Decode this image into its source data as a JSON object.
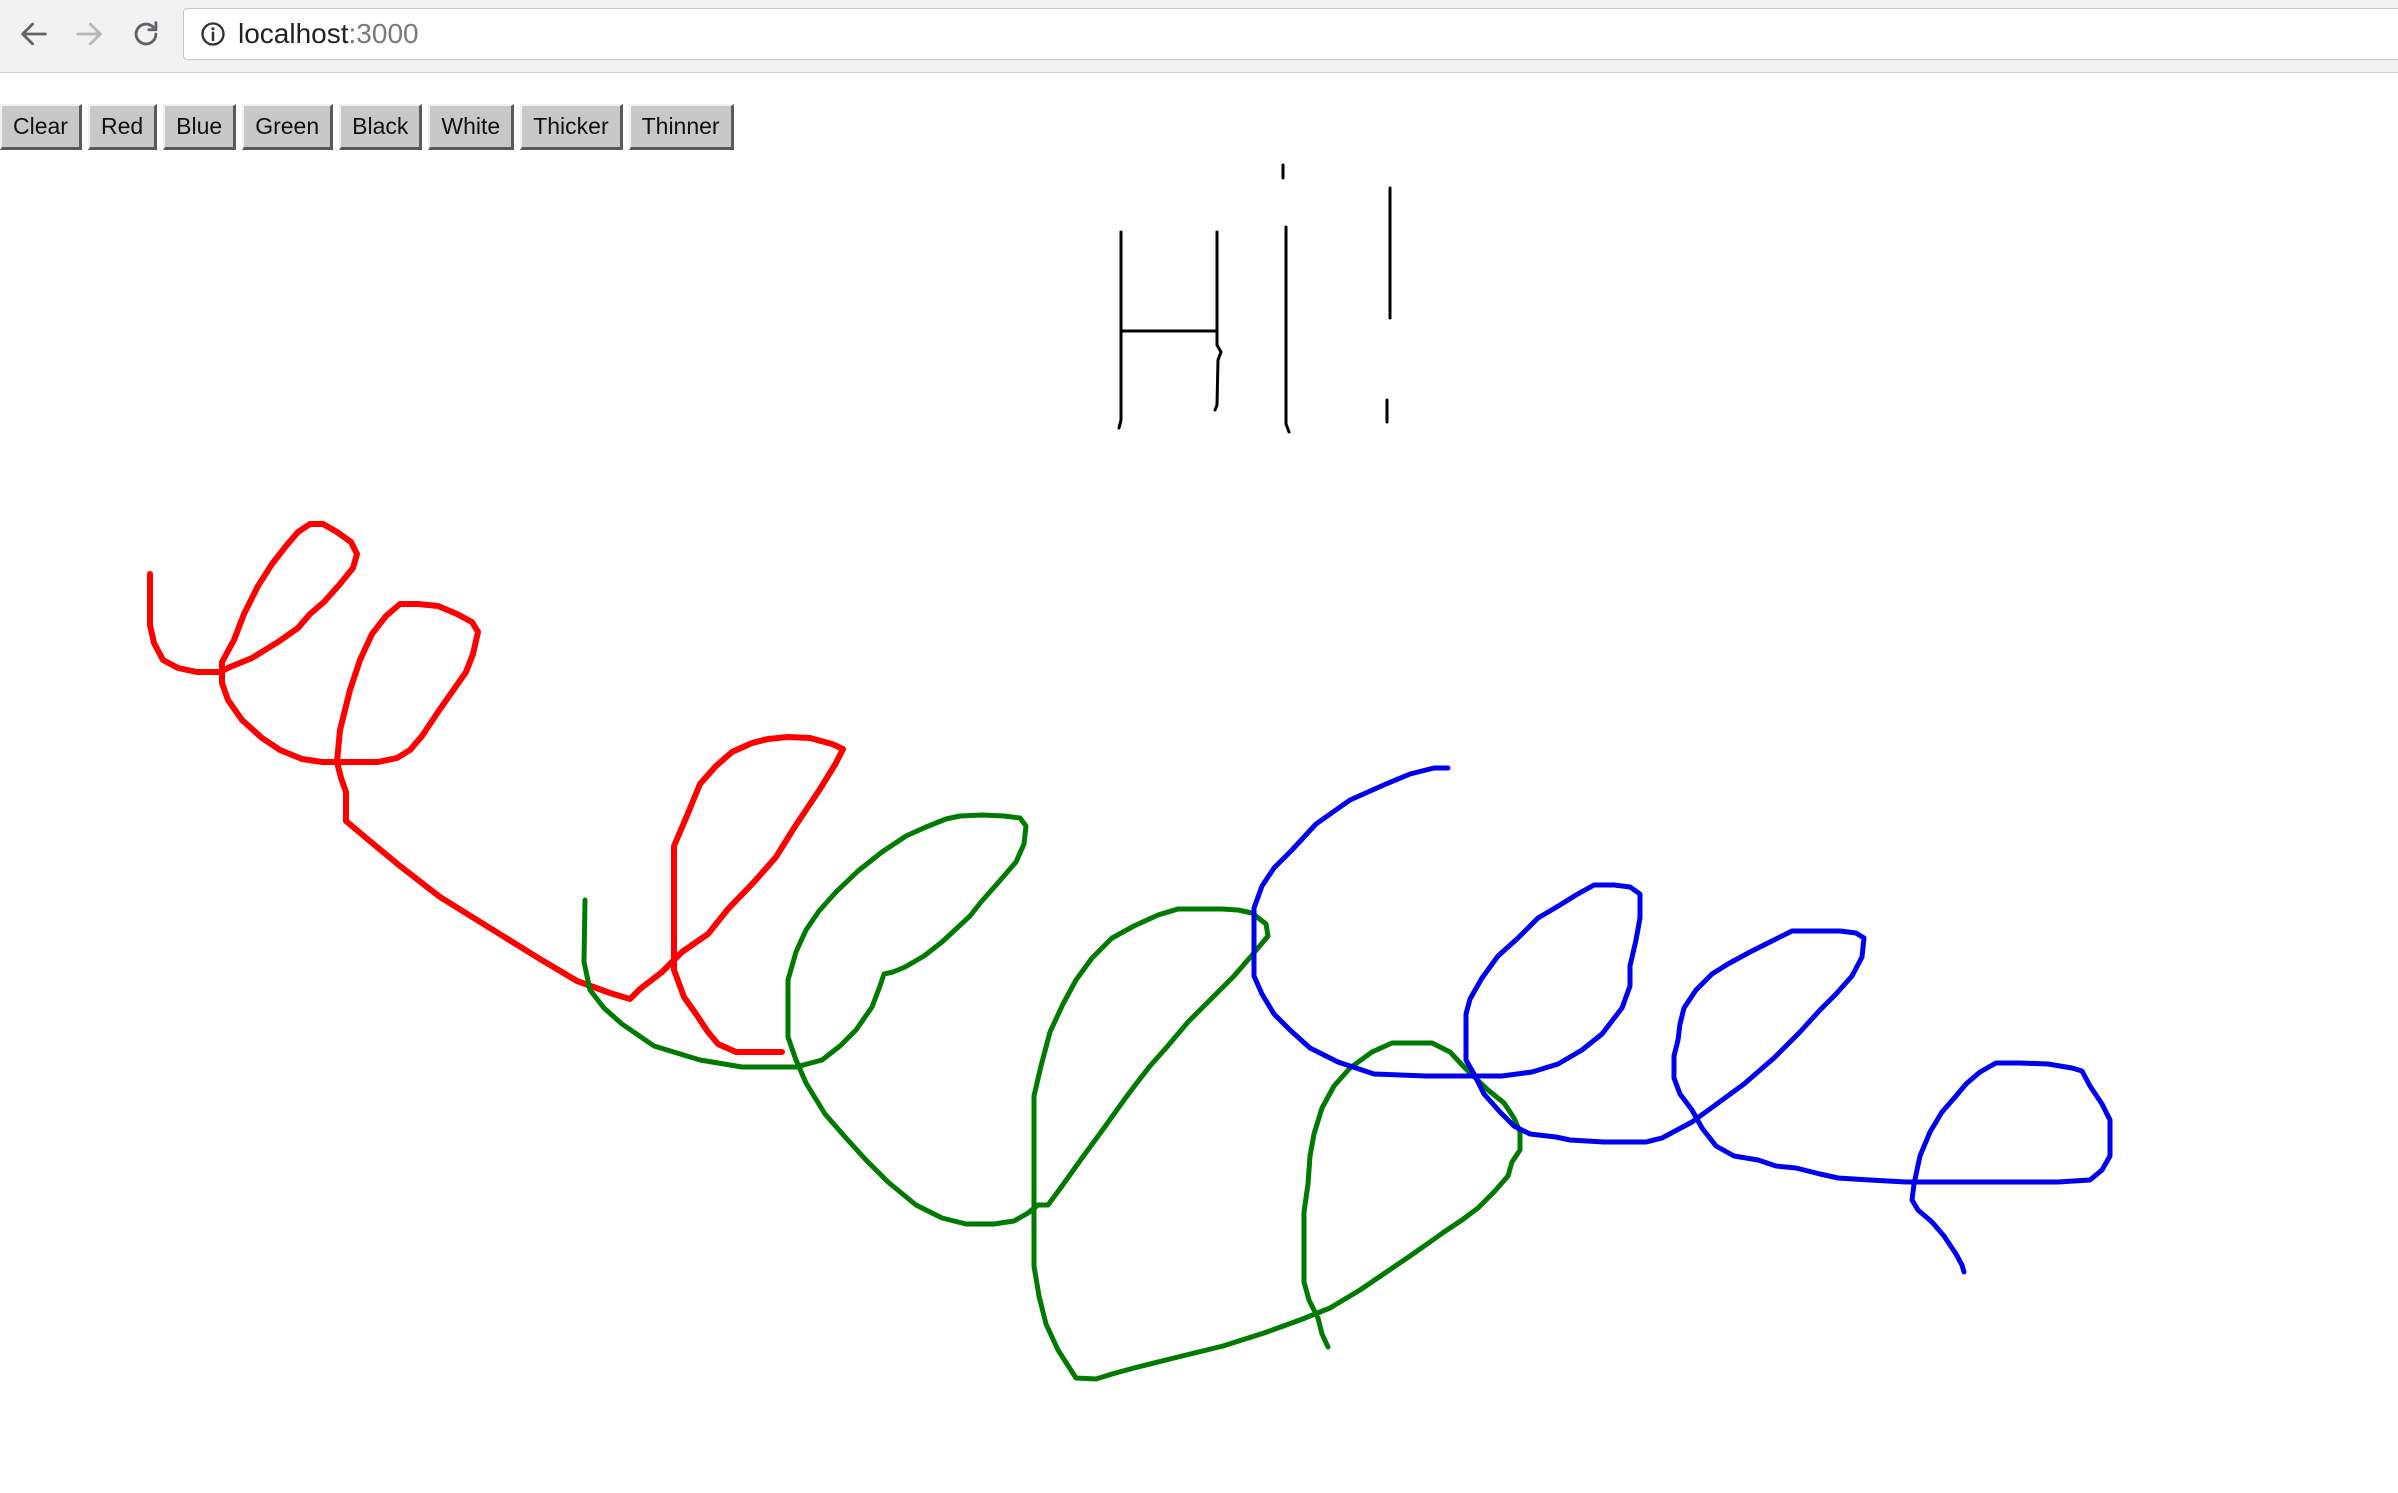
{
  "browser": {
    "url_host": "localhost",
    "url_port": ":3000",
    "icons": {
      "back": "back-arrow-icon",
      "forward": "forward-arrow-icon",
      "reload": "reload-icon",
      "info": "info-icon"
    }
  },
  "toolbar": {
    "buttons": [
      {
        "label": "Clear"
      },
      {
        "label": "Red"
      },
      {
        "label": "Blue"
      },
      {
        "label": "Green"
      },
      {
        "label": "Black"
      },
      {
        "label": "White"
      },
      {
        "label": "Thicker"
      },
      {
        "label": "Thinner"
      }
    ]
  },
  "colors": {
    "red": "#ff0000",
    "blue": "#0000ee",
    "green": "#007a00",
    "black": "#000000"
  }
}
